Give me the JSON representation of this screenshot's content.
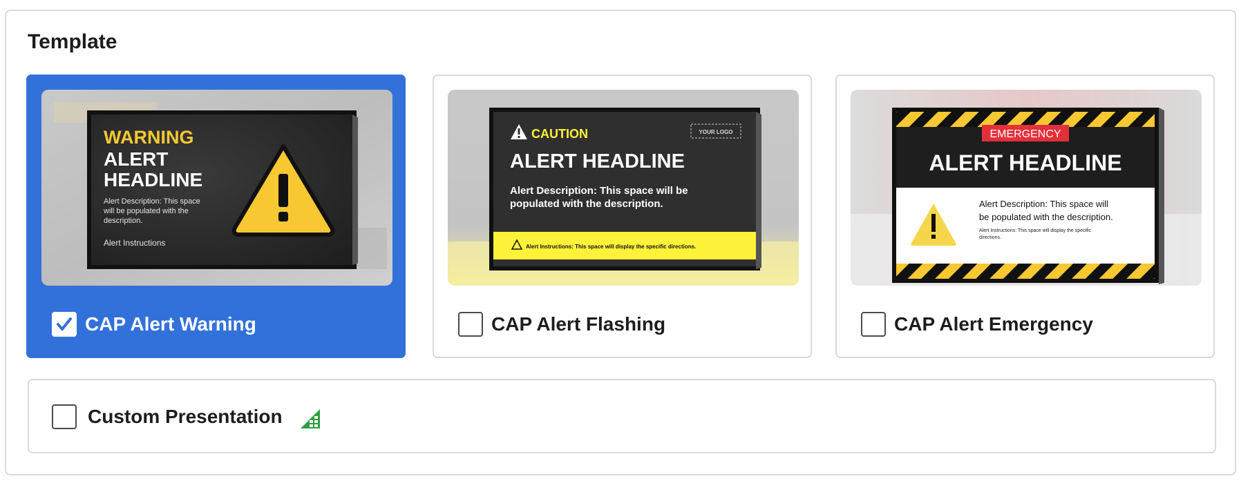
{
  "section": {
    "title": "Template"
  },
  "templates": [
    {
      "label": "CAP Alert Warning",
      "selected": true,
      "preview": {
        "kicker": "WARNING",
        "headline_line1": "ALERT",
        "headline_line2": "HEADLINE",
        "desc_line1": "Alert Description: This space",
        "desc_line2": "will be populated with the",
        "desc_line3": "description.",
        "instructions": "Alert Instructions"
      }
    },
    {
      "label": "CAP Alert Flashing",
      "selected": false,
      "preview": {
        "kicker": "CAUTION",
        "logo": "YOUR LOGO",
        "headline": "ALERT HEADLINE",
        "desc_line1": "Alert Description: This space will be",
        "desc_line2": "populated with the description.",
        "instructions": "Alert Instructions: This space will display the specific directions."
      }
    },
    {
      "label": "CAP Alert Emergency",
      "selected": false,
      "preview": {
        "kicker": "EMERGENCY",
        "headline": "ALERT HEADLINE",
        "desc_line1": "Alert Description: This space will",
        "desc_line2": "be populated with the description.",
        "instr_line1": "Alert Instructions: This space will display the specific",
        "instr_line2": "directions."
      }
    }
  ],
  "custom": {
    "label": "Custom Presentation",
    "checked": false,
    "icon": "spreadsheet-icon"
  },
  "colors": {
    "selected_bg": "#3271da",
    "warning_yellow": "#f7c832",
    "caution_yellow": "#fff23a",
    "emergency_red": "#e3303a",
    "sheet_green": "#2f9e44"
  }
}
